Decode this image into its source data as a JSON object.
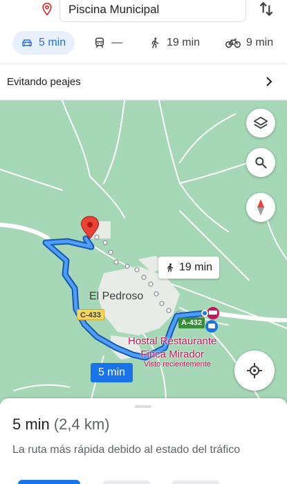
{
  "search": {
    "destination": "Piscina Municipal"
  },
  "modes": {
    "car": {
      "label": "5 min",
      "icon": "car-icon"
    },
    "transit": {
      "label": "—",
      "icon": "train-icon"
    },
    "walk": {
      "label": "19 min",
      "icon": "walk-icon"
    },
    "bike": {
      "label": "9 min",
      "icon": "bike-icon"
    }
  },
  "options": {
    "label": "Evitando peajes"
  },
  "map": {
    "walk_callout": "19 min",
    "town": "El Pedroso",
    "road_c433": "C-433",
    "road_a432": "A-432",
    "poi_name_line1": "Hostal Restaurante",
    "poi_name_line2": "Finca Mirador",
    "poi_subtitle": "Visto recientemente",
    "route_time": "5 min",
    "colors": {
      "land": "#a6d8b7",
      "route": "#1a73e8",
      "poi": "#c2185b",
      "marker": "#ea4335"
    }
  },
  "sheet": {
    "duration": "5 min",
    "distance": "(2,4 km)",
    "reason": "La ruta más rápida debido al estado del tráfico"
  }
}
